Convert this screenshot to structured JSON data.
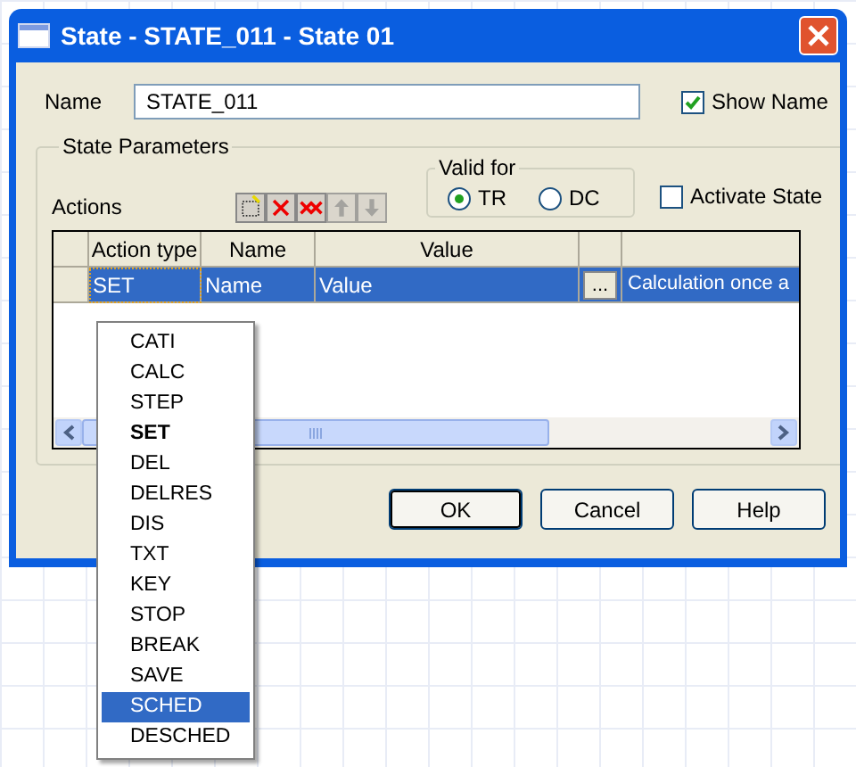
{
  "window": {
    "title": "State - STATE_011 - State 01"
  },
  "name_field": {
    "label": "Name",
    "value": "STATE_011"
  },
  "show_name": {
    "label": "Show Name",
    "checked": true
  },
  "parameters": {
    "title": "State Parameters"
  },
  "valid_for": {
    "title": "Valid for",
    "options": [
      {
        "label": "TR",
        "selected": true
      },
      {
        "label": "DC",
        "selected": false
      }
    ]
  },
  "activate_state": {
    "label": "Activate State",
    "checked": false
  },
  "actions": {
    "label": "Actions"
  },
  "toolbar": [
    {
      "kind": "new",
      "disabled": false
    },
    {
      "kind": "delete",
      "disabled": false
    },
    {
      "kind": "delete_all",
      "disabled": false
    },
    {
      "kind": "up",
      "disabled": true
    },
    {
      "kind": "down",
      "disabled": true
    }
  ],
  "table": {
    "columns": [
      "Action type",
      "Name",
      "Value"
    ],
    "rows": [
      {
        "action_type": "SET",
        "name": "Name",
        "value": "Value",
        "browse": "...",
        "column_6": "Calculation once a",
        "selected": true
      }
    ]
  },
  "dropdown": {
    "items": [
      {
        "label": "CATI",
        "current": false,
        "selected": false
      },
      {
        "label": "CALC",
        "current": false,
        "selected": false
      },
      {
        "label": "STEP",
        "current": false,
        "selected": false
      },
      {
        "label": "SET",
        "current": true,
        "selected": false
      },
      {
        "label": "DEL",
        "current": false,
        "selected": false
      },
      {
        "label": "DELRES",
        "current": false,
        "selected": false
      },
      {
        "label": "DIS",
        "current": false,
        "selected": false
      },
      {
        "label": "TXT",
        "current": false,
        "selected": false
      },
      {
        "label": "KEY",
        "current": false,
        "selected": false
      },
      {
        "label": "STOP",
        "current": false,
        "selected": false
      },
      {
        "label": "BREAK",
        "current": false,
        "selected": false
      },
      {
        "label": "SAVE",
        "current": false,
        "selected": false
      },
      {
        "label": "SCHED",
        "current": false,
        "selected": true
      },
      {
        "label": "DESCHED",
        "current": false,
        "selected": false
      }
    ]
  },
  "buttons": [
    {
      "label": "OK",
      "default": true
    },
    {
      "label": "Cancel",
      "default": false
    },
    {
      "label": "Help",
      "default": false
    }
  ]
}
